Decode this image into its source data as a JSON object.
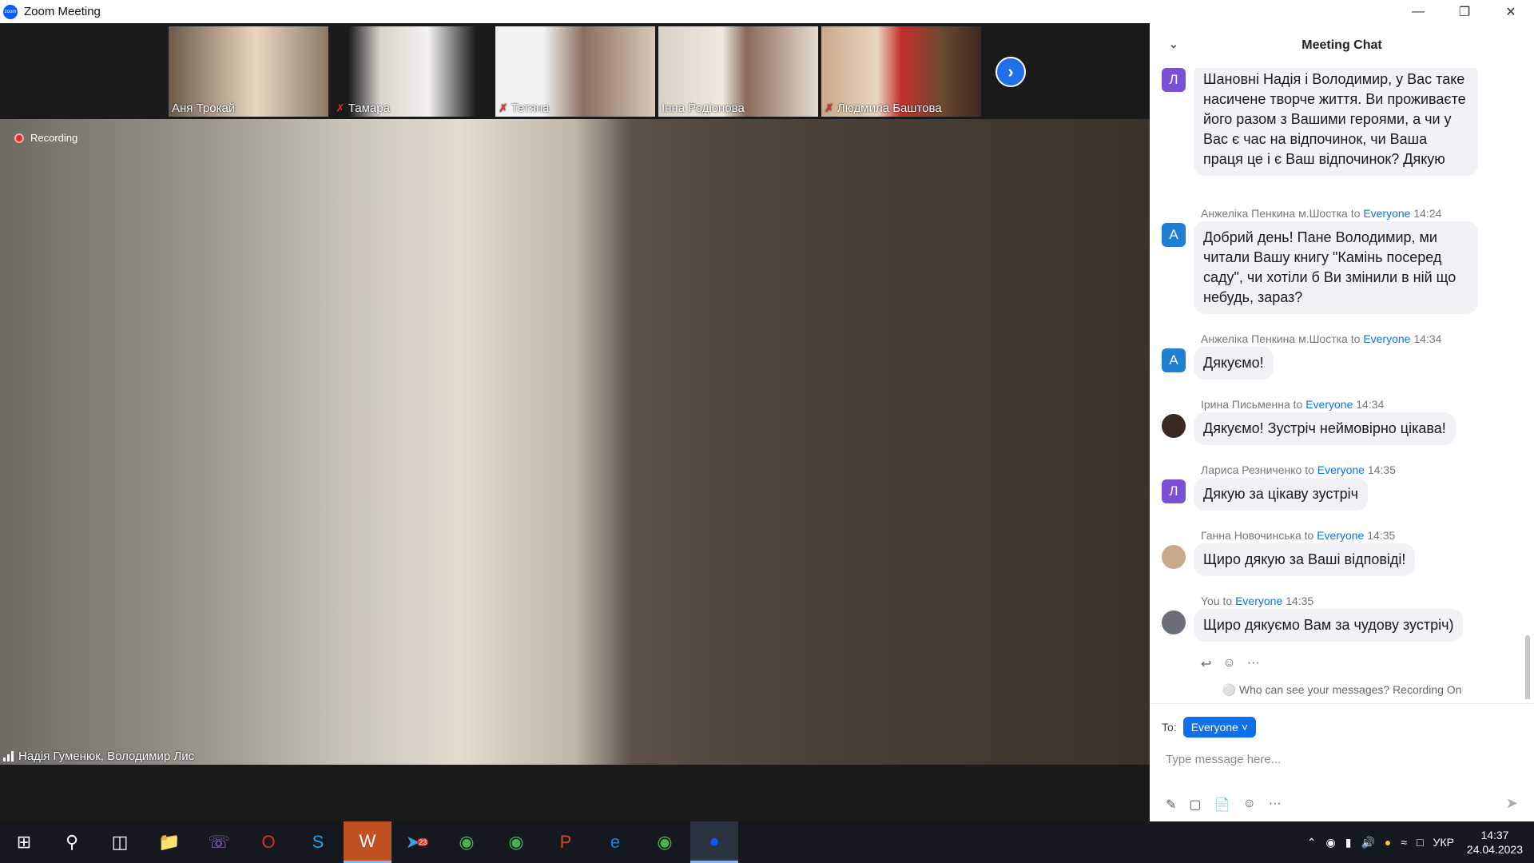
{
  "window": {
    "title": "Zoom Meeting",
    "app_icon_text": "zoom"
  },
  "gallery": {
    "participants": [
      {
        "name": "Аня Трокай",
        "muted": false
      },
      {
        "name": "Тамара",
        "muted": true
      },
      {
        "name": "Тетяна",
        "muted": true
      },
      {
        "name": "Інна Родіонова",
        "muted": false
      },
      {
        "name": "Людмила Баштова",
        "muted": true
      }
    ]
  },
  "main_video": {
    "recording_label": "Recording",
    "speaker_label": "Надія Гуменюк, Володимир Лис"
  },
  "chat": {
    "title": "Meeting Chat",
    "messages": [
      {
        "sender": "",
        "to": "",
        "time": "",
        "avatar_letter": "Л",
        "avatar_color": "#7b4fd6",
        "text": "Шановні Надія і Володимир, у Вас таке насичене творче життя. Ви проживаєте його разом з Вашими героями, а чи у Вас є час на відпочинок, чи Ваша праця це і є Ваш відпочинок? Дякую"
      },
      {
        "sender": "Анжеліка Пенкина м.Шостка",
        "to_prefix": "to",
        "to": "Everyone",
        "time": "14:24",
        "avatar_letter": "А",
        "avatar_color": "#1f7fd4",
        "text": "Добрий день! Пане Володимир, ми читали Вашу книгу \"Камінь посеред саду\", чи хотіли б Ви змінили в ній що небудь, зараз?"
      },
      {
        "sender": "Анжеліка Пенкина м.Шостка",
        "to_prefix": "to",
        "to": "Everyone",
        "time": "14:34",
        "avatar_letter": "А",
        "avatar_color": "#1f7fd4",
        "text": "Дякуємо!"
      },
      {
        "sender": "Ірина Письменна",
        "to_prefix": "to",
        "to": "Everyone",
        "time": "14:34",
        "avatar_letter": "",
        "avatar_color": "#3a2a24",
        "text": "Дякуємо! Зустріч неймовірно цікава!"
      },
      {
        "sender": "Лариса Резниченко",
        "to_prefix": "to",
        "to": "Everyone",
        "time": "14:35",
        "avatar_letter": "Л",
        "avatar_color": "#7b4fd6",
        "text": "Дякую за цікаву зустріч"
      },
      {
        "sender": "Ганна Новочинська",
        "to_prefix": "to",
        "to": "Everyone",
        "time": "14:35",
        "avatar_letter": "",
        "avatar_color": "#c9a98a",
        "text": "Щиро дякую за Ваші відповіді!"
      },
      {
        "sender": "You",
        "to_prefix": "to",
        "to": "Everyone",
        "time": "14:35",
        "avatar_letter": "",
        "avatar_color": "#6b7078",
        "text": "Щиро дякуємо Вам за чудову зустріч)"
      }
    ],
    "visibility_note": "Who can see your messages? Recording On",
    "to_label": "To:",
    "to_value": "Everyone",
    "input_placeholder": "Type message here..."
  },
  "taskbar": {
    "language": "УКР",
    "time": "14:37",
    "date": "24.04.2023",
    "telegram_badge": "23"
  }
}
